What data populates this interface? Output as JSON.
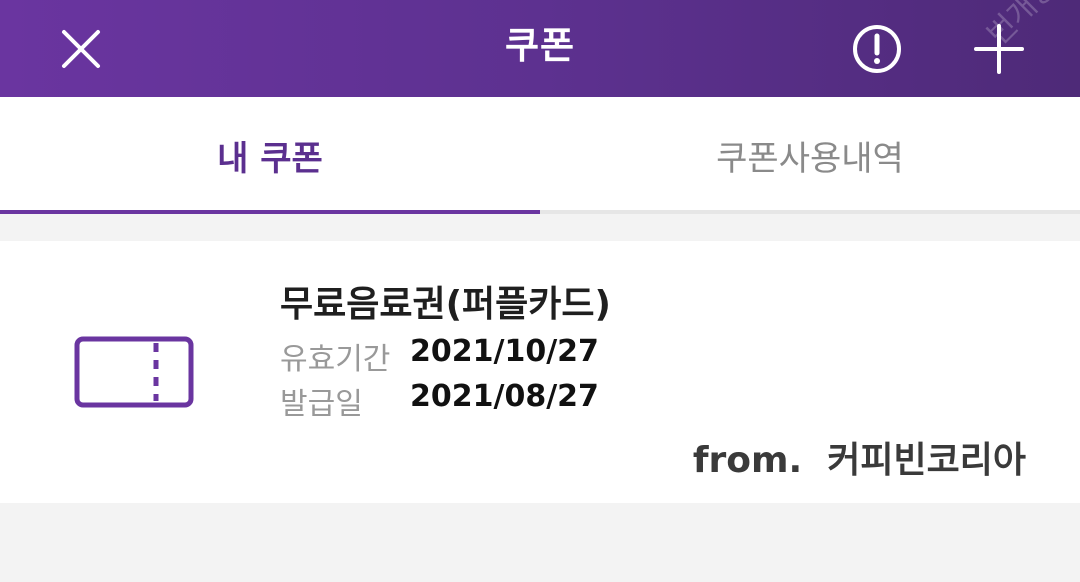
{
  "header": {
    "title": "쿠폰",
    "close_icon": "close-icon",
    "info_icon": "info-circle-icon",
    "add_icon": "plus-icon",
    "watermark": "번개장",
    "colors": {
      "gradient_start": "#6a35a0",
      "gradient_end": "#4e2a78",
      "icon": "#ffffff"
    }
  },
  "tabs": {
    "items": [
      {
        "label": "내 쿠폰",
        "active": true
      },
      {
        "label": "쿠폰사용내역",
        "active": false
      }
    ],
    "colors": {
      "active": "#5b2f8f",
      "inactive": "#8a8a8a",
      "indicator": "#6a35a0"
    }
  },
  "coupon": {
    "icon": "ticket-icon",
    "name": "무료음료권(퍼플카드)",
    "expiry_label": "유효기간",
    "expiry_value": "2021/10/27",
    "issued_label": "발급일",
    "issued_value": "2021/08/27",
    "from_label": "from.",
    "from_value": "커피빈코리아"
  }
}
